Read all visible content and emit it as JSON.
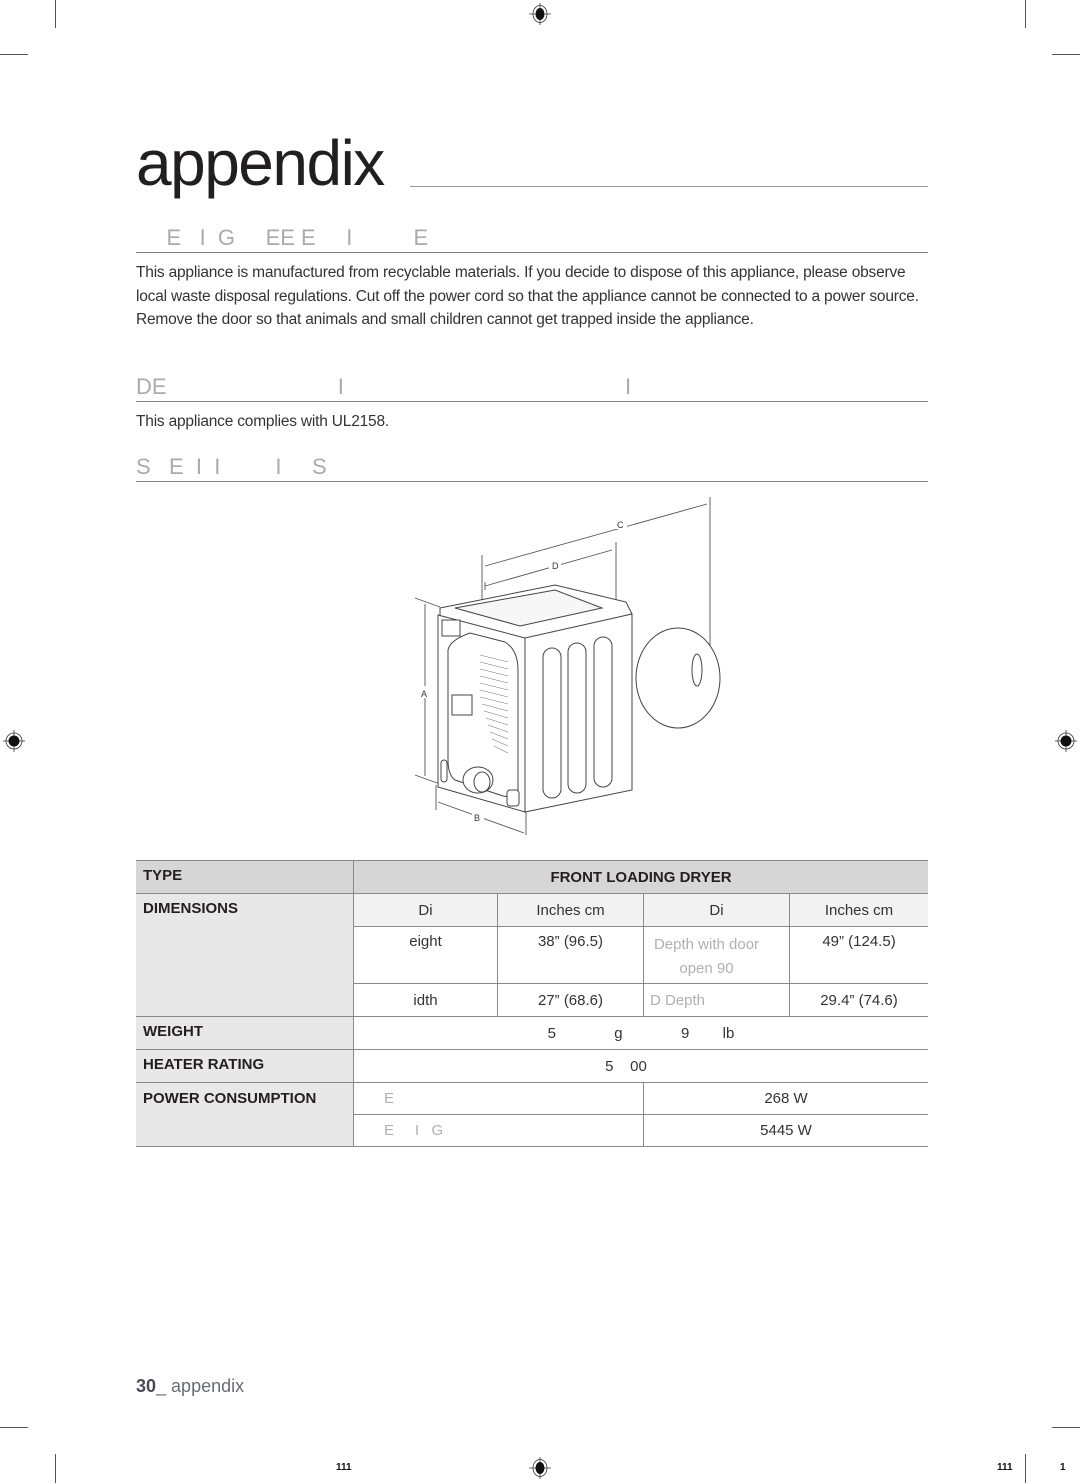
{
  "page": {
    "title": "appendix",
    "footer": {
      "page_number": "30",
      "separator": "_ ",
      "section": "appendix"
    },
    "print_marks": {
      "left_code": "111",
      "right_code": "111",
      "right_page": "1"
    }
  },
  "sections": [
    {
      "heading": "     E   I  G     EE E     I          E",
      "paragraph": "This appliance is manufactured from recyclable materials. If you decide to dispose of this appliance, please observe local waste disposal regulations. Cut off the power cord so that the appliance cannot be connected to a power source. Remove the door so that animals and small children cannot get trapped inside the appliance."
    },
    {
      "heading": "DE                            I                                              I",
      "paragraph": "This appliance complies with UL2158."
    },
    {
      "heading": "S   E  I  I         I     S",
      "paragraph": ""
    }
  ],
  "diagram": {
    "labels": {
      "a": "A",
      "b": "B",
      "c": "C",
      "d": "D"
    }
  },
  "specs": {
    "type_label": "TYPE",
    "type_value": "FRONT LOADING DRYER",
    "dimensions_label": "DIMENSIONS",
    "dim_header": [
      "Di",
      "Inches    cm",
      "Di",
      "Inches    cm"
    ],
    "dim_rows": [
      {
        "name1": "eight",
        "value1": "38” (96.5)",
        "name2": "Depth with door open 90",
        "value2": "49” (124.5)"
      },
      {
        "name1": "idth",
        "value1": "27” (68.6)",
        "name2": "D    Depth",
        "value2": "29.4” (74.6)"
      }
    ],
    "weight_label": "WEIGHT",
    "weight_value": "5              g              9        lb",
    "heater_label": "HEATER RATING",
    "heater_value": "5    00",
    "power_label": "POWER CONSUMPTION",
    "power_rows": [
      {
        "name": "E",
        "value": "268 W"
      },
      {
        "name": "E     I   G",
        "value": "5445 W"
      }
    ]
  }
}
